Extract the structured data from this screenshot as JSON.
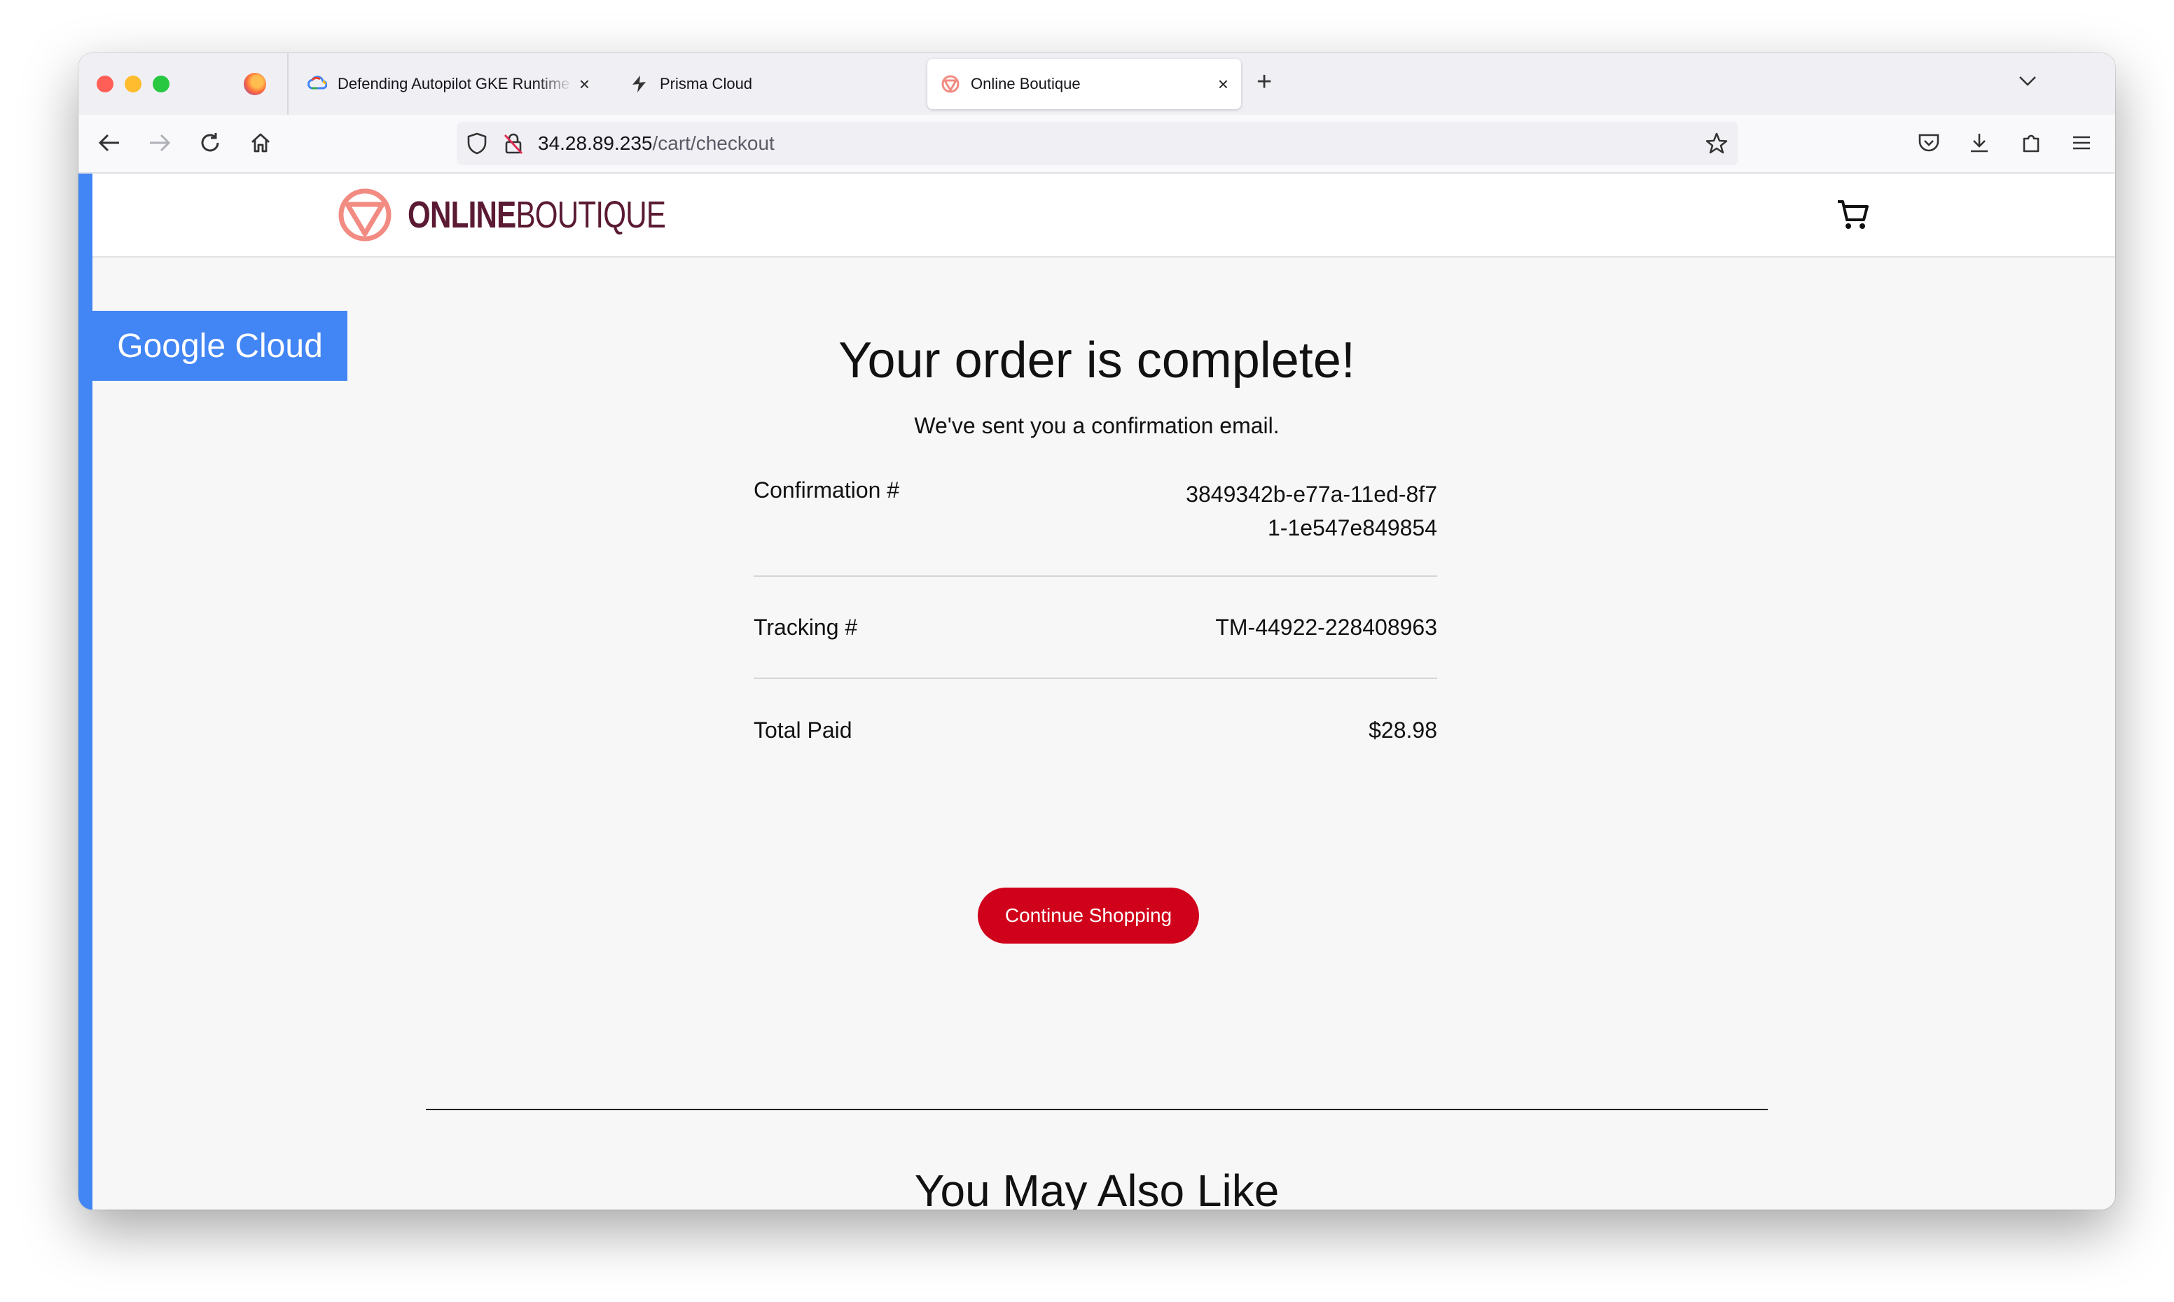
{
  "browser": {
    "tabs": [
      {
        "label": "Defending Autopilot GKE Runtime",
        "icon": "google-cloud-icon"
      },
      {
        "label": "Prisma Cloud",
        "icon": "prisma-cloud-icon"
      },
      {
        "label": "Online Boutique",
        "icon": "online-boutique-icon",
        "active": true
      }
    ],
    "close_glyph": "×",
    "new_tab_glyph": "+",
    "url_host": "34.28.89.235",
    "url_path": "/cart/checkout"
  },
  "site": {
    "brand_bold": "ONLINE",
    "brand_light": "BOUTIQUE",
    "badge": "Google Cloud",
    "brand_color": "#d0021b",
    "accent_blue": "#4285f4"
  },
  "order": {
    "title": "Your order is complete!",
    "subtitle": "We've sent you a confirmation email.",
    "rows": [
      {
        "label": "Confirmation #",
        "value": "3849342b-e77a-11ed-8f71-1e547e849854"
      },
      {
        "label": "Tracking #",
        "value": "TM-44922-228408963"
      },
      {
        "label": "Total Paid",
        "value": "$28.98"
      }
    ],
    "continue_label": "Continue Shopping"
  },
  "recommendations": {
    "heading": "You May Also Like"
  }
}
